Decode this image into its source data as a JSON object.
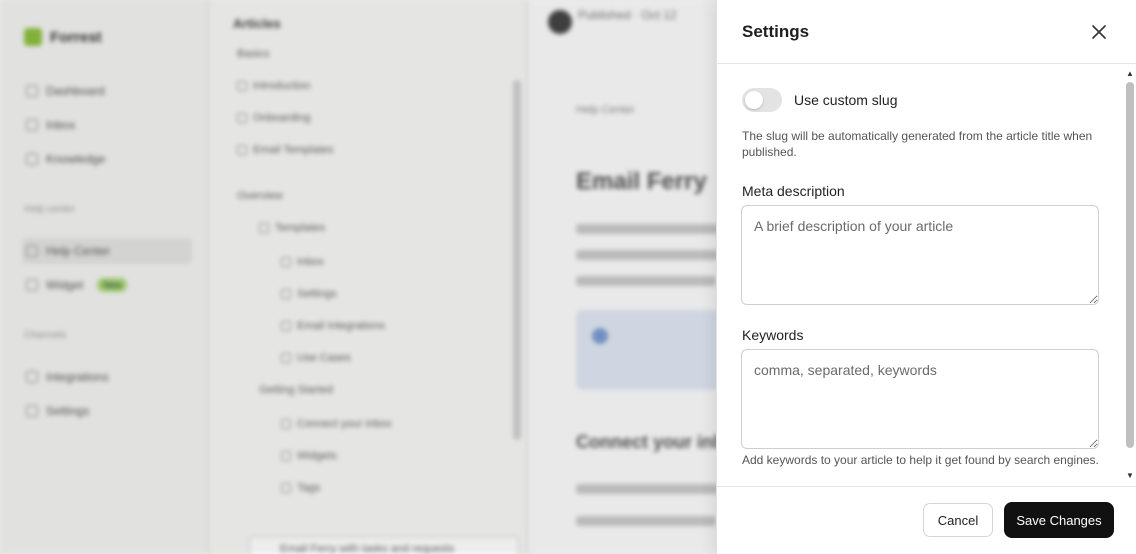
{
  "background": {
    "app_name": "Forrest",
    "nav": [
      "Dashboard",
      "Inbox",
      "Knowledge"
    ],
    "section_label": "Help center",
    "nav2": [
      "Help Center",
      "Widget"
    ],
    "widget_badge": "New",
    "section2_label": "Channels",
    "nav3": [
      "Integrations",
      "Settings"
    ],
    "tree_title": "Articles",
    "tree_items": [
      "Basics",
      "Introduction",
      "Onboarding",
      "Email Templates",
      "Overview",
      "Templates",
      "Inbox",
      "Settings",
      "Email Integrations",
      "Use Cases",
      "Getting Started",
      "Connect your inbox",
      "Widgets",
      "Tags"
    ],
    "tree_footer": "Email Ferry with tasks and requests",
    "author": "Published · Oct 12",
    "crumb": "Help Center",
    "article_title": "Email Ferry",
    "article_h2": "Connect your inbox"
  },
  "panel": {
    "title": "Settings",
    "close_icon": "close-icon",
    "custom_slug": {
      "label": "Use custom slug",
      "enabled": false,
      "hint": "The slug will be automatically generated from the article title when published."
    },
    "meta_description": {
      "label": "Meta description",
      "placeholder": "A brief description of your article",
      "value": ""
    },
    "keywords": {
      "label": "Keywords",
      "placeholder": "comma, separated, keywords",
      "value": "",
      "hint": "Add keywords to your article to help it get found by search engines."
    },
    "cancel_label": "Cancel",
    "save_label": "Save Changes"
  },
  "colors": {
    "primary_button": "#111111",
    "toggle_off": "#e3e3e3",
    "badge": "#a8d774"
  }
}
